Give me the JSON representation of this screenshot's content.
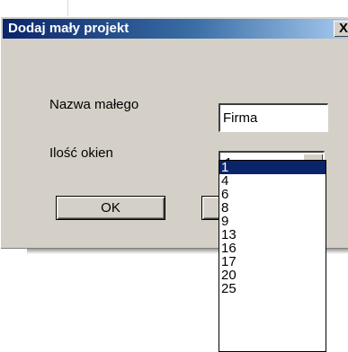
{
  "dialog": {
    "title": "Dodaj mały projekt",
    "close_label": "X",
    "name_label": "Nazwa małego",
    "name_value": "Firma",
    "windows_label": "Ilość okien",
    "windows_value": "1",
    "ok_label": "OK"
  },
  "dropdown": {
    "options": [
      "1",
      "4",
      "6",
      "8",
      "9",
      "13",
      "16",
      "17",
      "20",
      "25"
    ],
    "selected_index": 0
  },
  "colors": {
    "titlebar": "#0a246a",
    "dialog_face": "#d4d0c8",
    "selection": "#0a246a"
  }
}
